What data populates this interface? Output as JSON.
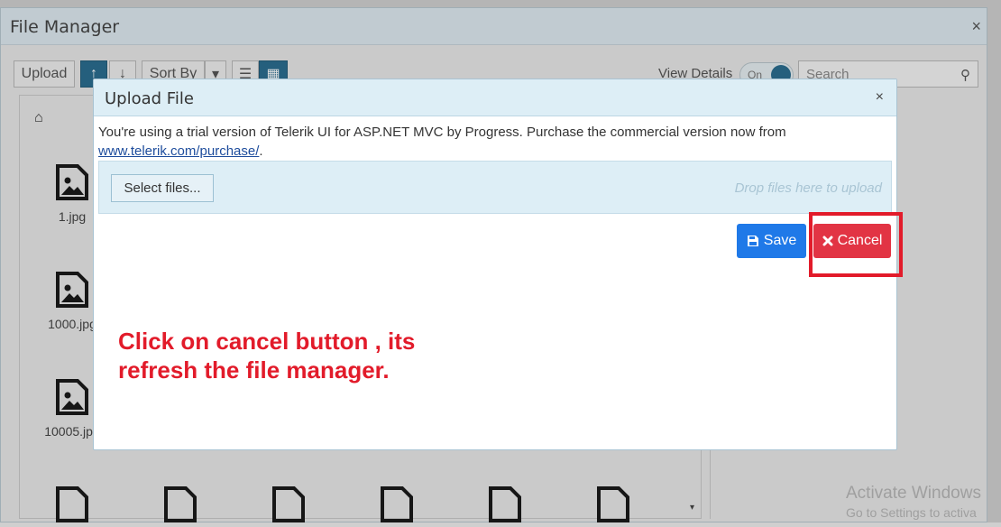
{
  "file_manager": {
    "title": "File Manager",
    "close": "×",
    "toolbar": {
      "upload_label": "Upload",
      "sort_asc": "↑",
      "sort_desc": "↓",
      "sort_by_label": "Sort By",
      "sort_dropdown": "▾",
      "view_list_icon": "☰",
      "view_grid_icon": "▦",
      "view_details_label": "View Details",
      "toggle_text": "On",
      "search_placeholder": "Search",
      "search_icon": "⚲"
    },
    "breadcrumb_icon": "⌂",
    "files": [
      {
        "name": "1.jpg"
      },
      {
        "name": "1000.jpg"
      },
      {
        "name": "10005.jpg"
      }
    ],
    "scroll_arrow": "▾"
  },
  "dialog": {
    "title": "Upload File",
    "close": "×",
    "trial_text": "You're using a trial version of Telerik UI for ASP.NET MVC by Progress. Purchase the commercial version now from",
    "trial_link": "www.telerik.com/purchase/",
    "trial_end": ".",
    "select_files": "Select files...",
    "drop_hint": "Drop files here to upload",
    "save_label": "Save",
    "cancel_label": "Cancel"
  },
  "annotation": {
    "line1": "Click on cancel button , its",
    "line2": "refresh the file manager."
  },
  "watermark": {
    "line1": "Activate Windows",
    "line2": "Go to Settings to activa"
  },
  "colors": {
    "primary": "#1f79e8",
    "danger": "#e23444",
    "annotation": "#e21b2a",
    "toolbar_active": "#2b6d8f"
  }
}
